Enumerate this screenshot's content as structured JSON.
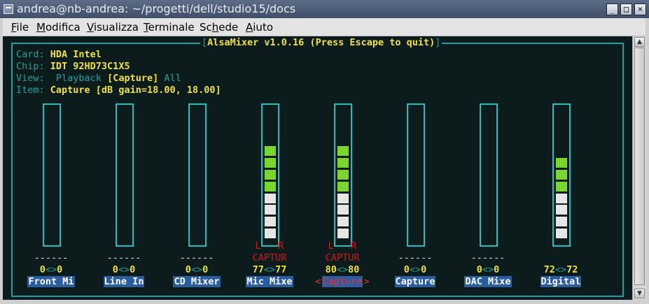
{
  "window": {
    "title": "andrea@nb-andrea: ~/progetti/dell/studio15/docs",
    "buttons": {
      "minimize": "_",
      "maximize": "□",
      "close": "×"
    }
  },
  "menubar": [
    {
      "pre": "",
      "u": "F",
      "post": "ile"
    },
    {
      "pre": "",
      "u": "M",
      "post": "odifica"
    },
    {
      "pre": "",
      "u": "V",
      "post": "isualizza"
    },
    {
      "pre": "",
      "u": "T",
      "post": "erminale"
    },
    {
      "pre": "Sc",
      "u": "h",
      "post": "ede"
    },
    {
      "pre": "",
      "u": "A",
      "post": "iuto"
    }
  ],
  "mixer": {
    "title": "AlsaMixer v1.0.16 (Press Escape to quit)",
    "card_label": "Card:",
    "card_value": "HDA Intel",
    "chip_label": "Chip:",
    "chip_value": "IDT 92HD73C1X5",
    "view_label": "View:",
    "view_playback": "Playback",
    "view_capture": "[Capture]",
    "view_all": "All",
    "item_label": "Item:",
    "item_value": "Capture [dB gain=18.00, 18.00]",
    "channels": [
      {
        "name": "Front Mi",
        "left": "0",
        "right": "0",
        "dashes": "------",
        "level": 0,
        "selected": false
      },
      {
        "name": "Line In",
        "left": "0",
        "right": "0",
        "dashes": "------",
        "level": 0,
        "selected": false
      },
      {
        "name": "CD Mixer",
        "left": "0",
        "right": "0",
        "dashes": "------",
        "level": 0,
        "selected": false
      },
      {
        "name": "Mic Mixe",
        "left": "77",
        "right": "77",
        "capture_lr": "L   R",
        "capture_text": "CAPTUR",
        "level": 0.77,
        "selected": false
      },
      {
        "name": "Capture",
        "left": "80",
        "right": "80",
        "capture_lr": "L   R",
        "capture_text": "CAPTUR",
        "level": 0.8,
        "selected": true,
        "sel_left": "<",
        "sel_right": ">"
      },
      {
        "name": "Capture",
        "left": "0",
        "right": "0",
        "dashes": "------",
        "level": 0,
        "selected": false
      },
      {
        "name": "DAC Mixe",
        "left": "0",
        "right": "0",
        "dashes": "------",
        "level": 0,
        "selected": false
      },
      {
        "name": "Digital",
        "left": "72",
        "right": "72",
        "dashes": "",
        "level": 0.72,
        "selected": false
      }
    ]
  },
  "colors": {
    "terminal_bg": "#0c1c1c",
    "frame_cyan": "#20a0a0",
    "value_yellow": "#f0e040",
    "capture_red": "#d01818",
    "name_bg": "#2a5ca0"
  }
}
